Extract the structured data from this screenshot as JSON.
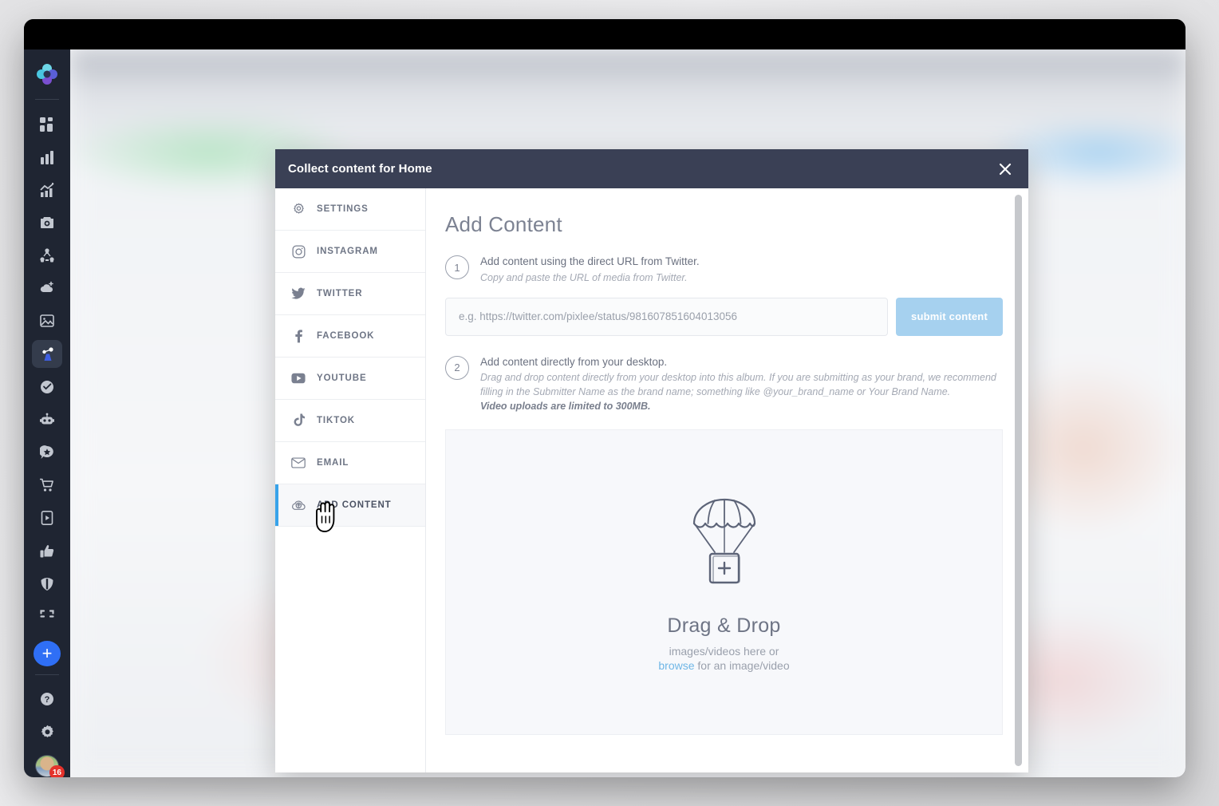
{
  "app": {
    "rail": {
      "logo_name": "pixlee-logo",
      "items": [
        {
          "name": "dashboard-icon",
          "label": "Dashboard"
        },
        {
          "name": "bar-chart-icon",
          "label": "Analytics"
        },
        {
          "name": "trend-chart-icon",
          "label": "Trends"
        },
        {
          "name": "camera-icon",
          "label": "Photos"
        },
        {
          "name": "network-icon",
          "label": "Community"
        },
        {
          "name": "add-cloud-icon",
          "label": "Collect"
        },
        {
          "name": "image-icon",
          "label": "Media"
        },
        {
          "name": "content-flow-icon",
          "label": "Content Flow"
        },
        {
          "name": "approve-icon",
          "label": "Approvals"
        },
        {
          "name": "robot-icon",
          "label": "Automation"
        },
        {
          "name": "review-star-icon",
          "label": "Reviews"
        },
        {
          "name": "cart-icon",
          "label": "Commerce"
        },
        {
          "name": "mobile-video-icon",
          "label": "Stories"
        },
        {
          "name": "thumbs-up-icon",
          "label": "Engagement"
        },
        {
          "name": "shield-icon",
          "label": "Rights"
        },
        {
          "name": "crop-icon",
          "label": "Crop"
        }
      ],
      "add_button_label": "+",
      "footer_items": [
        {
          "name": "help-icon",
          "label": "Help"
        },
        {
          "name": "gear-icon",
          "label": "Settings"
        }
      ],
      "avatar_badge": "16"
    }
  },
  "modal": {
    "title": "Collect content for Home",
    "close_label": "✕",
    "menu": [
      {
        "name": "sidebar-item-settings",
        "icon": "gear-icon",
        "label": "SETTINGS",
        "active": false
      },
      {
        "name": "sidebar-item-instagram",
        "icon": "instagram-icon",
        "label": "INSTAGRAM",
        "active": false
      },
      {
        "name": "sidebar-item-twitter",
        "icon": "twitter-icon",
        "label": "TWITTER",
        "active": false
      },
      {
        "name": "sidebar-item-facebook",
        "icon": "facebook-icon",
        "label": "FACEBOOK",
        "active": false
      },
      {
        "name": "sidebar-item-youtube",
        "icon": "youtube-icon",
        "label": "YOUTUBE",
        "active": false
      },
      {
        "name": "sidebar-item-tiktok",
        "icon": "tiktok-icon",
        "label": "TIKTOK",
        "active": false
      },
      {
        "name": "sidebar-item-email",
        "icon": "email-icon",
        "label": "EMAIL",
        "active": false
      },
      {
        "name": "sidebar-item-add-content",
        "icon": "upload-cloud-icon",
        "label": "ADD CONTENT",
        "active": true
      }
    ],
    "content": {
      "heading": "Add Content",
      "step1": {
        "number": "1",
        "title": "Add content using the direct URL from Twitter.",
        "subtitle": "Copy and paste the URL of media from Twitter.",
        "input_placeholder": "e.g. https://twitter.com/pixlee/status/981607851604013056",
        "input_value": "",
        "submit_label": "submit content"
      },
      "step2": {
        "number": "2",
        "title": "Add content directly from your desktop.",
        "subtitle": "Drag and drop content directly from your desktop into this album. If you are submitting as your brand, we recommend filling in the Submitter Name as the brand name; something like @your_brand_name or Your Brand Name.",
        "note": "Video uploads are limited to 300MB."
      },
      "dropzone": {
        "icon": "parachute-upload-icon",
        "title": "Drag & Drop",
        "sub_prefix": "images/videos here or",
        "browse_label": "browse",
        "sub_suffix": "for an image/video"
      }
    }
  },
  "colors": {
    "modal_header": "#3a4055",
    "accent_blue": "#38a3ea",
    "submit_button": "#a6d1ef",
    "rail_bg": "#1f2532",
    "add_button": "#2f6ff5",
    "badge_red": "#e4322b"
  }
}
